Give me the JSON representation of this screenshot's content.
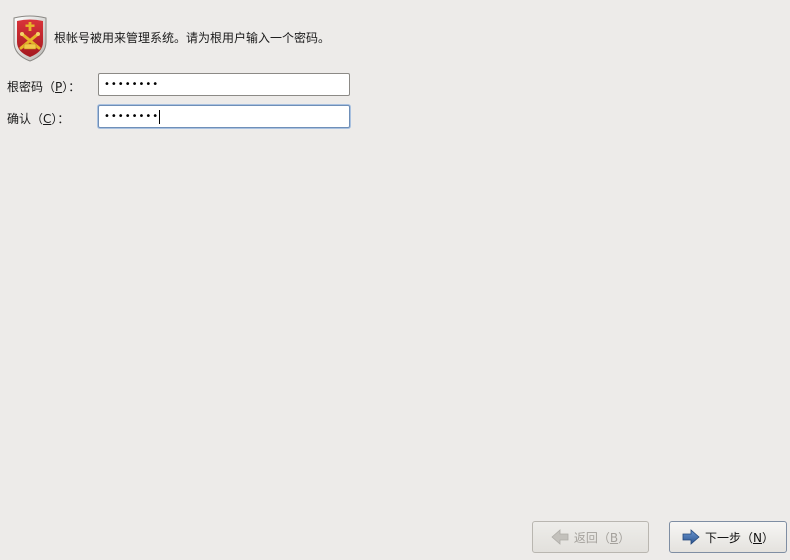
{
  "header": {
    "icon": "shield-emblem-icon",
    "message": "根帐号被用来管理系统。请为根用户输入一个密码。"
  },
  "form": {
    "password": {
      "label_prefix": "根密码（",
      "mnemonic": "P",
      "label_suffix": "）：",
      "masked_value": "••••••••"
    },
    "confirm": {
      "label_prefix": "确认（",
      "mnemonic": "C",
      "label_suffix": "）：",
      "masked_value": "••••••••"
    }
  },
  "buttons": {
    "back": {
      "icon": "arrow-left-icon",
      "label_prefix": "返回（",
      "mnemonic": "B",
      "label_suffix": "）",
      "enabled": false
    },
    "next": {
      "icon": "arrow-right-icon",
      "label_prefix": "下一步（",
      "mnemonic": "N",
      "label_suffix": "）",
      "enabled": true
    }
  },
  "colors": {
    "background": "#edebe9",
    "focus_border": "#6f8fb8",
    "arrow_blue": "#3d6aa6",
    "shield_red": "#c8232c",
    "shield_gold": "#e8b52a"
  }
}
